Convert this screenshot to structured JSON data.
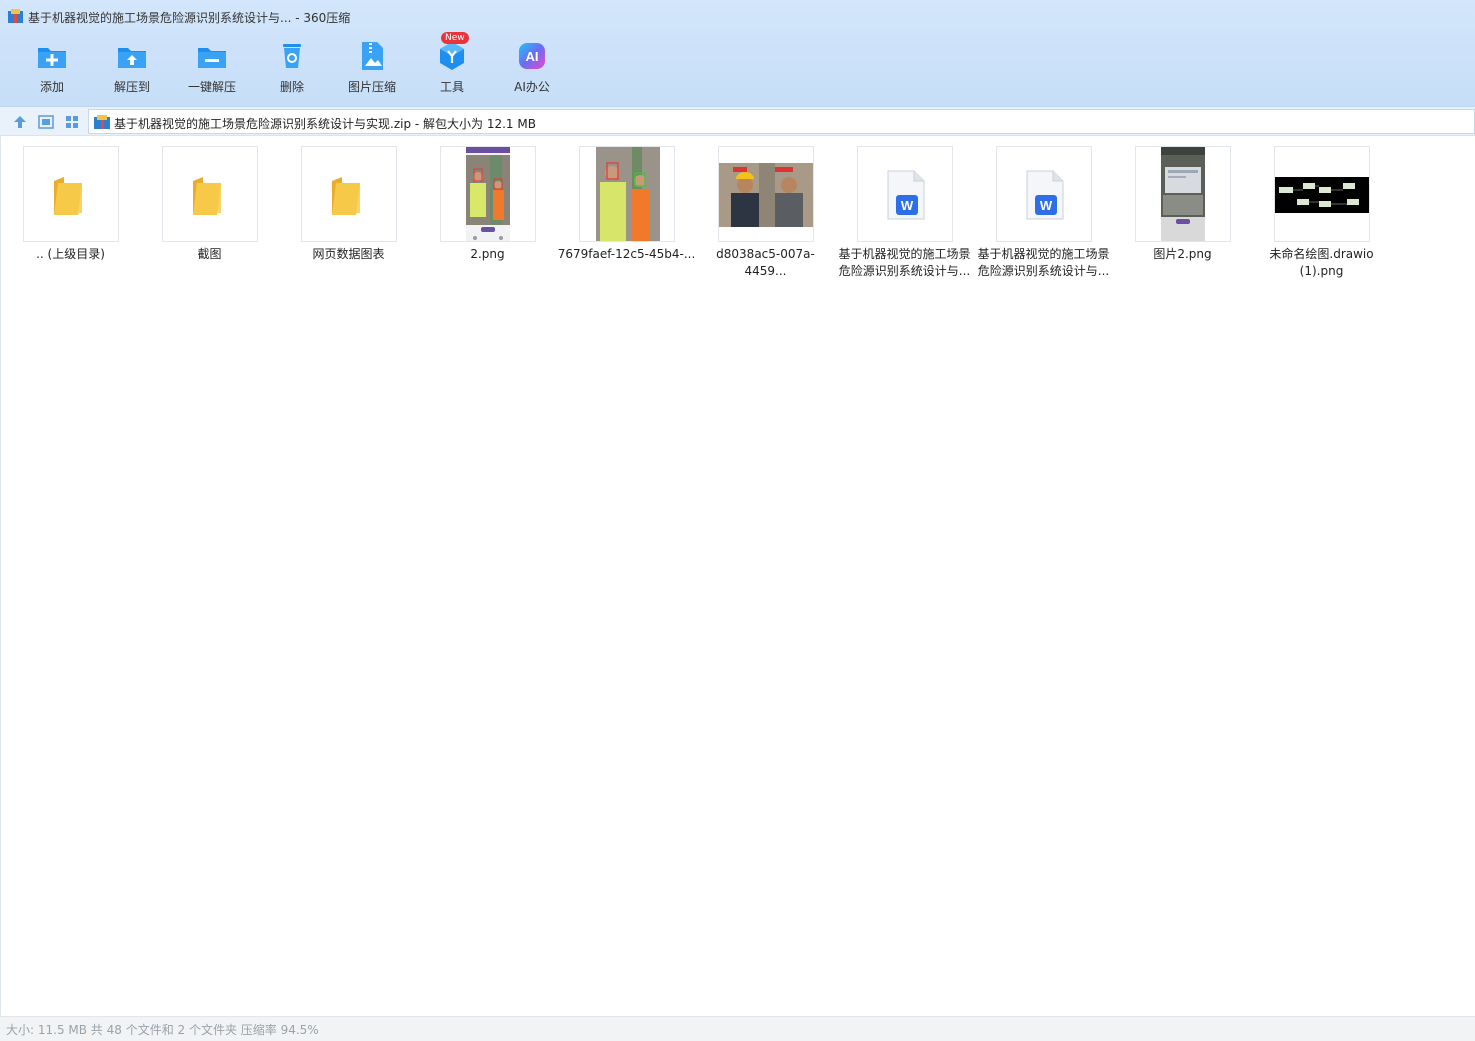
{
  "window": {
    "title": "基于机器视觉的施工场景危险源识别系统设计与... - 360压缩"
  },
  "toolbar": {
    "items": [
      {
        "label": "添加",
        "icon": "add-folder-icon"
      },
      {
        "label": "解压到",
        "icon": "extract-to-icon"
      },
      {
        "label": "一键解压",
        "icon": "one-click-extract-icon"
      },
      {
        "label": "删除",
        "icon": "recycle-bin-icon"
      },
      {
        "label": "图片压缩",
        "icon": "image-compress-icon"
      },
      {
        "label": "工具",
        "icon": "tools-icon"
      },
      {
        "label": "AI办公",
        "icon": "ai-office-icon"
      }
    ],
    "new_badge": "New"
  },
  "address": {
    "path": "基于机器视觉的施工场景危险源识别系统设计与实现.zip - 解包大小为 12.1 MB"
  },
  "files": [
    {
      "name": ".. (上级目录)",
      "type": "folder"
    },
    {
      "name": "截图",
      "type": "folder"
    },
    {
      "name": "网页数据图表",
      "type": "folder"
    },
    {
      "name": "2.png",
      "type": "image-portrait-phone"
    },
    {
      "name": "7679faef-12c5-45b4-...",
      "type": "image-portrait-workers"
    },
    {
      "name": "d8038ac5-007a-4459...",
      "type": "image-landscape-workers"
    },
    {
      "name": "基于机器视觉的施工场景危险源识别系统设计与...",
      "type": "word-document"
    },
    {
      "name": "基于机器视觉的施工场景危险源识别系统设计与...",
      "type": "word-document"
    },
    {
      "name": "图片2.png",
      "type": "image-portrait-laptop"
    },
    {
      "name": "未命名绘图.drawio (1).png",
      "type": "image-diagram"
    }
  ],
  "status": {
    "text": "大小: 11.5 MB 共 48 个文件和 2 个文件夹 压缩率 94.5%"
  },
  "colors": {
    "accent": "#1e8fee",
    "folder": "#f7c948",
    "word": "#2e6fe8",
    "badge": "#e8343a"
  }
}
